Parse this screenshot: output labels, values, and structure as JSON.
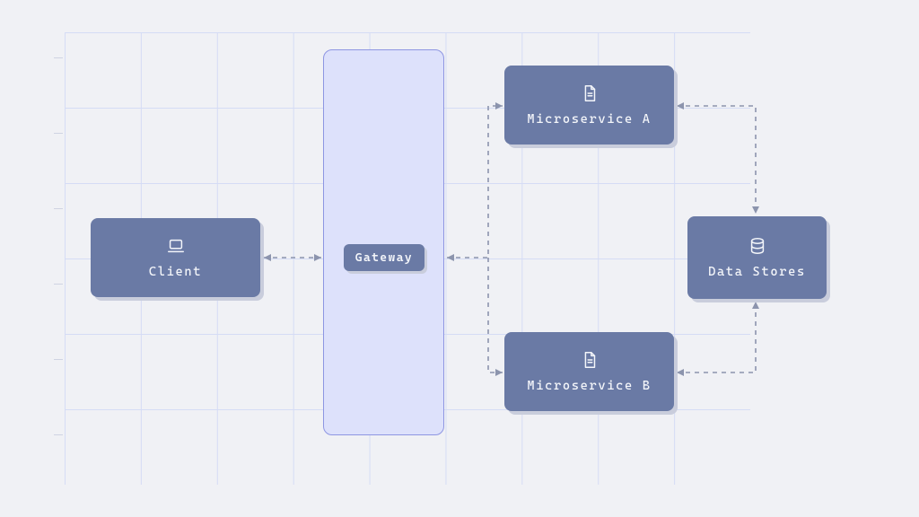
{
  "colors": {
    "background": "#f0f1f5",
    "grid_line": "#d5dcf5",
    "node_fill": "#6a7aa5",
    "node_text": "#f4f6fa",
    "node_shadow": "#c9cddc",
    "gateway_container_fill": "#dde1fb",
    "gateway_container_border": "#8e96e2",
    "connector": "#8c94ad"
  },
  "nodes": {
    "client": {
      "label": "Client",
      "icon": "laptop-icon"
    },
    "gateway": {
      "label": "Gateway"
    },
    "microservice_a": {
      "label": "Microservice A",
      "icon": "document-icon"
    },
    "microservice_b": {
      "label": "Microservice B",
      "icon": "document-icon"
    },
    "data_stores": {
      "label": "Data Stores",
      "icon": "database-icon"
    }
  },
  "connections": [
    {
      "from": "client",
      "to": "gateway",
      "bidirectional": true
    },
    {
      "from": "gateway",
      "to": "microservice_a",
      "bidirectional": true
    },
    {
      "from": "gateway",
      "to": "microservice_b",
      "bidirectional": true
    },
    {
      "from": "microservice_a",
      "to": "data_stores",
      "bidirectional": true
    },
    {
      "from": "microservice_b",
      "to": "data_stores",
      "bidirectional": true
    }
  ]
}
